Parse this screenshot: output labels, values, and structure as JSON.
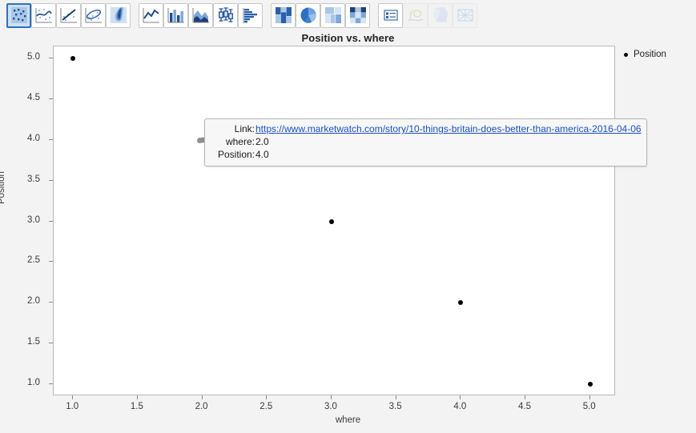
{
  "toolbar": {
    "groups": [
      {
        "name": "distribution-group",
        "buttons": [
          {
            "icon": "scatter-plot-icon",
            "label": "Scatter Plot",
            "state": "selected"
          },
          {
            "icon": "smoother-curve-icon",
            "label": "Smoother",
            "state": "normal"
          },
          {
            "icon": "regression-line-icon",
            "label": "Line of Fit",
            "state": "normal"
          },
          {
            "icon": "ellipse-contour-icon",
            "label": "Normal Ellipse",
            "state": "normal"
          },
          {
            "icon": "density-contour-icon",
            "label": "Contour",
            "state": "normal"
          }
        ]
      },
      {
        "name": "series-group",
        "buttons": [
          {
            "icon": "line-chart-icon",
            "label": "Line Chart",
            "state": "normal"
          },
          {
            "icon": "bar-chart-icon",
            "label": "Bar Chart",
            "state": "normal"
          },
          {
            "icon": "area-chart-icon",
            "label": "Area Chart",
            "state": "normal"
          },
          {
            "icon": "box-plot-icon",
            "label": "Box Plot",
            "state": "normal"
          },
          {
            "icon": "histogram-icon",
            "label": "Histogram",
            "state": "normal"
          }
        ]
      },
      {
        "name": "categorical-group",
        "buttons": [
          {
            "icon": "mosaic-plot-icon",
            "label": "Mosaic Plot",
            "state": "normal"
          },
          {
            "icon": "pie-chart-icon",
            "label": "Pie Chart",
            "state": "normal"
          },
          {
            "icon": "treemap-icon",
            "label": "Treemap",
            "state": "normal"
          },
          {
            "icon": "tiled-heatmap-icon",
            "label": "Heatmap",
            "state": "normal"
          }
        ]
      },
      {
        "name": "annotation-group",
        "buttons": [
          {
            "icon": "legend-table-icon",
            "label": "Legend",
            "state": "normal"
          },
          {
            "icon": "formula-function-icon",
            "label": "Formula",
            "state": "disabled"
          },
          {
            "icon": "map-shape-icon",
            "label": "Map Shape",
            "state": "disabled"
          },
          {
            "icon": "mesh-grid-icon",
            "label": "Mesh",
            "state": "disabled"
          }
        ]
      }
    ]
  },
  "legend": {
    "entries": [
      {
        "label": "Position",
        "color": "#000000"
      }
    ]
  },
  "tooltip": {
    "rows": [
      {
        "key": "Link:",
        "value": "https://www.marketwatch.com/story/10-things-britain-does-better-than-america-2016-04-06",
        "is_link": true
      },
      {
        "key": "where:",
        "value": "2.0",
        "is_link": false
      },
      {
        "key": "Position:",
        "value": "4.0",
        "is_link": false
      }
    ]
  },
  "chart_data": {
    "type": "scatter",
    "title": "Position vs. where",
    "xlabel": "where",
    "ylabel": "Position",
    "xlim": [
      0.85,
      5.2
    ],
    "ylim": [
      0.85,
      5.15
    ],
    "grid": false,
    "legend_position": "right",
    "xticks": [
      "1.0",
      "1.5",
      "2.0",
      "2.5",
      "3.0",
      "3.5",
      "4.0",
      "4.5",
      "5.0"
    ],
    "xtick_values": [
      1.0,
      1.5,
      2.0,
      2.5,
      3.0,
      3.5,
      4.0,
      4.5,
      5.0
    ],
    "yticks": [
      "1.0",
      "1.5",
      "2.0",
      "2.5",
      "3.0",
      "3.5",
      "4.0",
      "4.5",
      "5.0"
    ],
    "ytick_values": [
      1.0,
      1.5,
      2.0,
      2.5,
      3.0,
      3.5,
      4.0,
      4.5,
      5.0
    ],
    "series": [
      {
        "name": "Position",
        "color": "#000000",
        "x": [
          1.0,
          2.0,
          3.0,
          4.0,
          5.0
        ],
        "y": [
          5.0,
          4.0,
          3.0,
          2.0,
          1.0
        ],
        "hovered_index": 1
      }
    ]
  }
}
